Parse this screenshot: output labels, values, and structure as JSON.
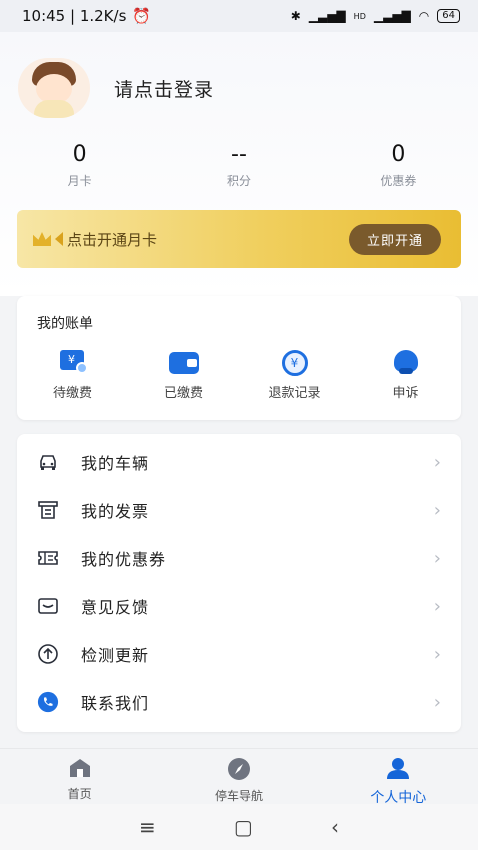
{
  "status_bar": {
    "time_speed": "10:45 | 1.2K/s",
    "alarm_icon": "alarm-icon",
    "signal_text": "HD",
    "battery": "64"
  },
  "profile": {
    "login_prompt": "请点击登录"
  },
  "stats": [
    {
      "value": "0",
      "label": "月卡"
    },
    {
      "value": "--",
      "label": "积分"
    },
    {
      "value": "0",
      "label": "优惠券"
    }
  ],
  "month_card": {
    "text": "点击开通月卡",
    "button": "立即开通"
  },
  "bills": {
    "title": "我的账单",
    "items": [
      {
        "label": "待缴费",
        "icon": "pending-payment-icon"
      },
      {
        "label": "已缴费",
        "icon": "wallet-icon"
      },
      {
        "label": "退款记录",
        "icon": "refund-icon"
      },
      {
        "label": "申诉",
        "icon": "customer-service-icon"
      }
    ]
  },
  "menu": [
    {
      "label": "我的车辆",
      "icon": "car-icon"
    },
    {
      "label": "我的发票",
      "icon": "invoice-icon"
    },
    {
      "label": "我的优惠券",
      "icon": "coupon-icon"
    },
    {
      "label": "意见反馈",
      "icon": "feedback-icon"
    },
    {
      "label": "检测更新",
      "icon": "update-icon"
    },
    {
      "label": "联系我们",
      "icon": "phone-icon"
    }
  ],
  "tabs": [
    {
      "label": "首页",
      "icon": "home-icon",
      "active": false
    },
    {
      "label": "停车导航",
      "icon": "compass-icon",
      "active": false
    },
    {
      "label": "个人中心",
      "icon": "person-icon",
      "active": true
    }
  ],
  "colors": {
    "accent": "#1565d8",
    "gold": "#f0cf5e",
    "button_brown": "#7a5a2c"
  }
}
